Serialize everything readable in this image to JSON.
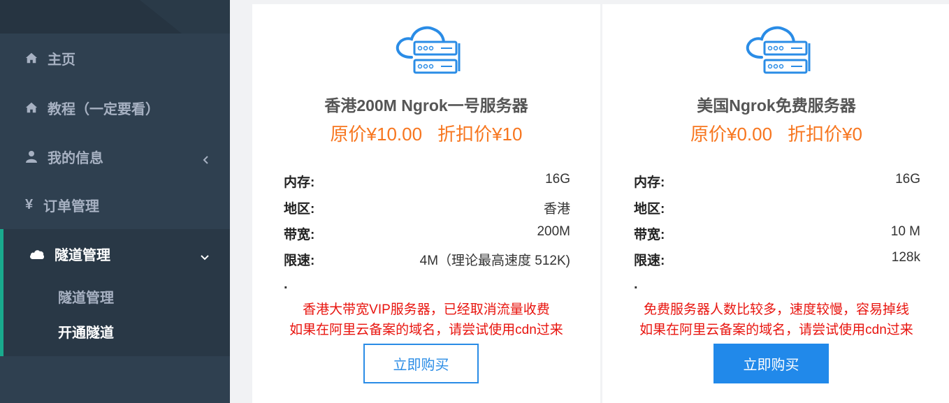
{
  "sidebar": {
    "items": [
      {
        "label": "主页",
        "icon": "home-icon"
      },
      {
        "label": "教程（一定要看）",
        "icon": "home-icon"
      },
      {
        "label": "我的信息",
        "icon": "user-icon"
      },
      {
        "label": "订单管理",
        "icon": "yen-icon",
        "glyph": "¥"
      },
      {
        "label": "隧道管理",
        "icon": "cloud-icon"
      }
    ],
    "sub_items": [
      {
        "label": "隧道管理"
      },
      {
        "label": "开通隧道"
      }
    ],
    "accent_color": "#19aa8d"
  },
  "cards": [
    {
      "title": "香港200M Ngrok一号服务器",
      "original_price": "原价¥10.00",
      "discount_price": "折扣价¥10",
      "specs": [
        {
          "key": "内存:",
          "value": "16G"
        },
        {
          "key": "地区:",
          "value": "香港"
        },
        {
          "key": "带宽:",
          "value": "200M"
        },
        {
          "key": "限速:",
          "value": "4M（理论最高速度 512K)"
        }
      ],
      "dot": ".",
      "notes": [
        "香港大带宽VIP服务器，已经取消流量收费",
        "如果在阿里云备案的域名，请尝试使用cdn过来"
      ],
      "button": "立即购买"
    },
    {
      "title": "美国Ngrok免费服务器",
      "original_price": "原价¥0.00",
      "discount_price": "折扣价¥0",
      "specs": [
        {
          "key": "内存:",
          "value": "16G"
        },
        {
          "key": "地区:",
          "value": ""
        },
        {
          "key": "带宽:",
          "value": "10 M"
        },
        {
          "key": "限速:",
          "value": "128k"
        }
      ],
      "dot": ".",
      "notes": [
        "免费服务器人数比较多，速度较慢，容易掉线",
        "如果在阿里云备案的域名，请尝试使用cdn过来"
      ],
      "button": "立即购买"
    }
  ],
  "colors": {
    "price": "#f7761f",
    "note": "#e8150f",
    "button_blue": "#2189ea"
  }
}
